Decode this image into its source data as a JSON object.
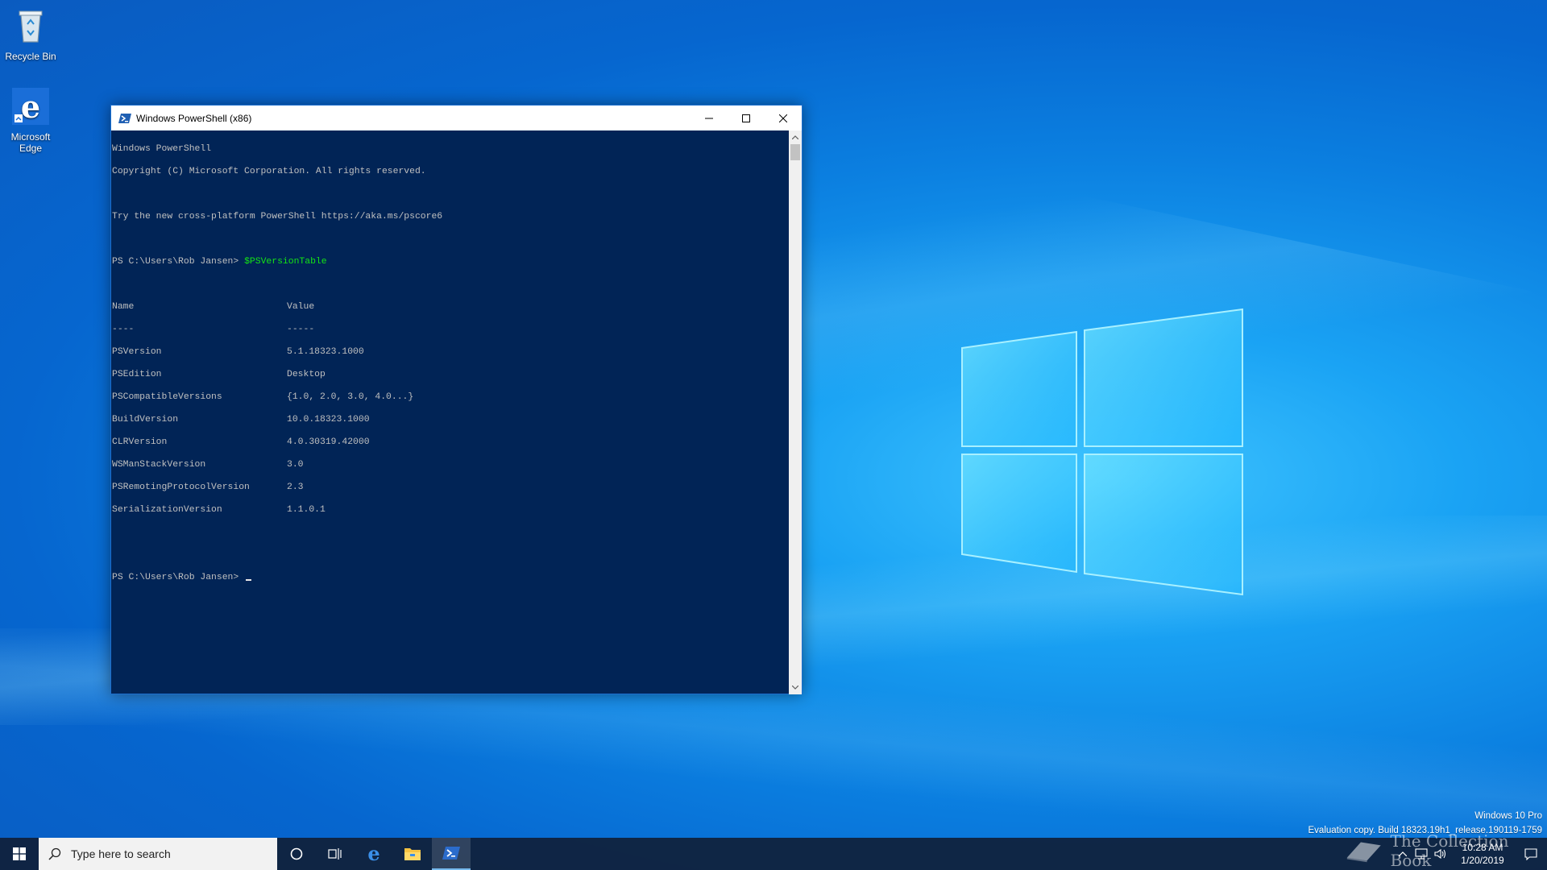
{
  "desktop": {
    "icons": [
      {
        "label": "Recycle Bin"
      },
      {
        "label": "Microsoft Edge"
      }
    ]
  },
  "window": {
    "title": "Windows PowerShell (x86)",
    "console": {
      "header1": "Windows PowerShell",
      "header2": "Copyright (C) Microsoft Corporation. All rights reserved.",
      "header3": "Try the new cross-platform PowerShell https://aka.ms/pscore6",
      "prompt": "PS C:\\Users\\Rob Jansen> ",
      "command": "$PSVersionTable",
      "table_headers": [
        "Name",
        "Value"
      ],
      "table_separators": [
        "----",
        "-----"
      ],
      "rows": [
        {
          "name": "PSVersion",
          "value": "5.1.18323.1000"
        },
        {
          "name": "PSEdition",
          "value": "Desktop"
        },
        {
          "name": "PSCompatibleVersions",
          "value": "{1.0, 2.0, 3.0, 4.0...}"
        },
        {
          "name": "BuildVersion",
          "value": "10.0.18323.1000"
        },
        {
          "name": "CLRVersion",
          "value": "4.0.30319.42000"
        },
        {
          "name": "WSManStackVersion",
          "value": "3.0"
        },
        {
          "name": "PSRemotingProtocolVersion",
          "value": "2.3"
        },
        {
          "name": "SerializationVersion",
          "value": "1.1.0.1"
        }
      ],
      "prompt2": "PS C:\\Users\\Rob Jansen> "
    }
  },
  "watermark": {
    "line1": "Windows 10 Pro",
    "line2": "Evaluation copy. Build 18323.19h1_release.190119-1759",
    "brand": "The Collection Book"
  },
  "taskbar": {
    "search_placeholder": "Type here to search",
    "apps": [
      "cortana-icon",
      "task-view-icon",
      "edge-icon",
      "file-explorer-icon",
      "powershell-icon"
    ],
    "clock_time": "10:28 AM",
    "clock_date": "1/20/2019"
  },
  "colors": {
    "console_bg": "#012456",
    "console_text": "#c0c0c0",
    "command_text": "#14e414",
    "taskbar_bg": "#102038"
  }
}
